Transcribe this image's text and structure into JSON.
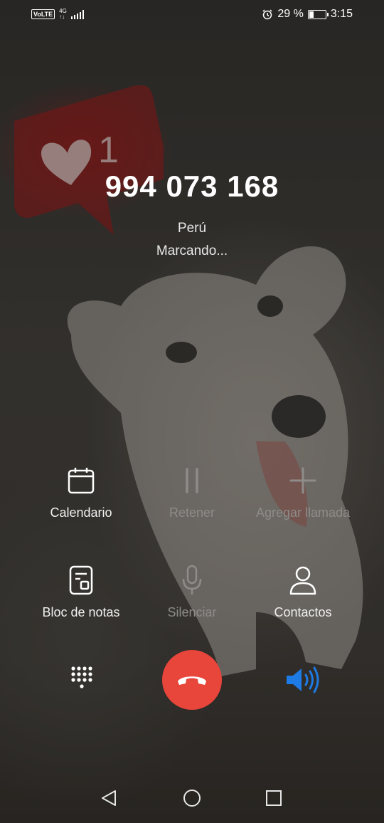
{
  "status_bar": {
    "volte": "VoLTE",
    "network": "4G",
    "battery_percent": "29 %",
    "time": "3:15",
    "battery_level": 0.29
  },
  "call": {
    "number": "994 073 168",
    "location": "Perú",
    "status": "Marcando..."
  },
  "badge": {
    "count": "1"
  },
  "actions": [
    {
      "label": "Calendario",
      "icon": "calendar-icon",
      "enabled": true
    },
    {
      "label": "Retener",
      "icon": "pause-icon",
      "enabled": false
    },
    {
      "label": "Agregar llamada",
      "icon": "plus-icon",
      "enabled": false
    },
    {
      "label": "Bloc de notas",
      "icon": "notepad-icon",
      "enabled": true
    },
    {
      "label": "Silenciar",
      "icon": "microphone-icon",
      "enabled": false
    },
    {
      "label": "Contactos",
      "icon": "person-icon",
      "enabled": true
    }
  ],
  "controls": {
    "keypad": "dialpad-icon",
    "end_call": "end-call-icon",
    "speaker": "speaker-icon",
    "speaker_color": "#1e7be5",
    "end_call_color": "#e8453b"
  },
  "navigation": [
    "back-icon",
    "home-icon",
    "recents-icon"
  ]
}
